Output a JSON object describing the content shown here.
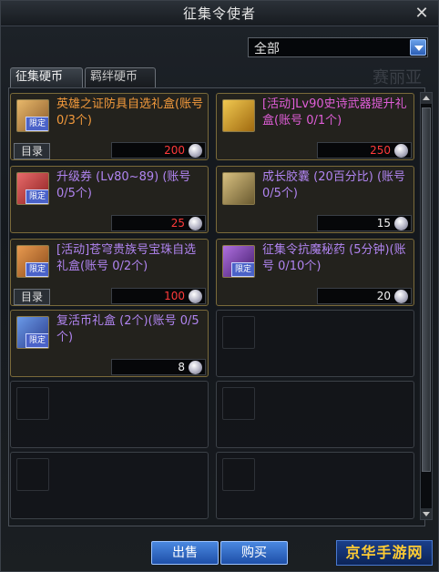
{
  "window": {
    "title": "征集令使者",
    "close_symbol": "✕"
  },
  "filter": {
    "selected": "全部"
  },
  "background_text": "赛丽亚",
  "tabs": [
    {
      "label": "征集硬币"
    },
    {
      "label": "羁绊硬币"
    }
  ],
  "items": [
    {
      "name": "英雄之证防具自选礼盒(账号 0/3个)",
      "name_color": "orange",
      "limited_badge": "限定",
      "catalog_label": "目录",
      "price": "200",
      "price_color": "red"
    },
    {
      "name": "[活动]Lv90史诗武器提升礼盒(账号 0/1个)",
      "name_color": "pink",
      "limited_badge": "",
      "catalog_label": "",
      "price": "250",
      "price_color": "red"
    },
    {
      "name": "升级券 (Lv80~89) (账号 0/5个)",
      "name_color": "purple",
      "limited_badge": "限定",
      "catalog_label": "",
      "price": "25",
      "price_color": "red"
    },
    {
      "name": "成长胶囊 (20百分比) (账号 0/5个)",
      "name_color": "purple",
      "limited_badge": "",
      "catalog_label": "",
      "price": "15",
      "price_color": "white"
    },
    {
      "name": "[活动]苍穹贵族号宝珠自选礼盒(账号 0/2个)",
      "name_color": "purple",
      "limited_badge": "限定",
      "catalog_label": "目录",
      "price": "100",
      "price_color": "red"
    },
    {
      "name": "征集令抗魔秘药 (5分钟)(账号 0/10个)",
      "name_color": "purple",
      "limited_badge": "限定",
      "catalog_label": "",
      "price": "20",
      "price_color": "white"
    },
    {
      "name": "复活币礼盒 (2个)(账号 0/5个)",
      "name_color": "purple",
      "limited_badge": "限定",
      "catalog_label": "",
      "price": "8",
      "price_color": "white"
    }
  ],
  "buttons": {
    "sell": "出售",
    "buy": "购买"
  },
  "watermark": "京华手游网"
}
